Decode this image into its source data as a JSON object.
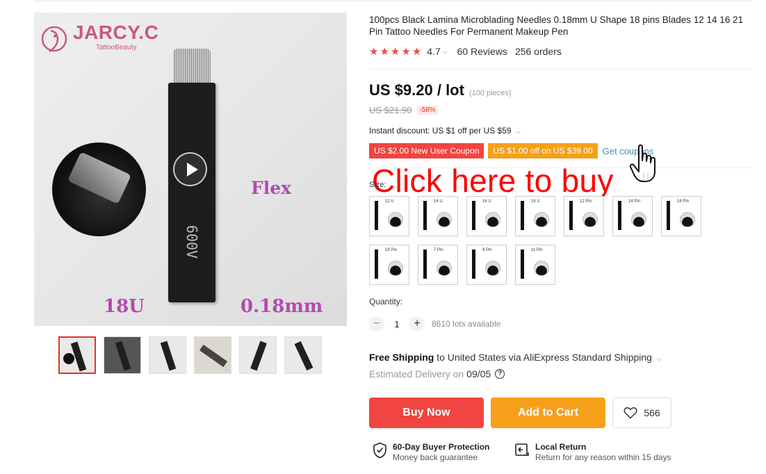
{
  "product": {
    "title": "100pcs Black Lamina Microblading Needles 0.18mm U Shape 18 pins Blades 12 14 16 21 Pin Tattoo Needles For Permanent Makeup Pen",
    "rating": "4.7",
    "reviews": "60 Reviews",
    "orders": "256 orders",
    "star_color": "#f04b4b"
  },
  "image": {
    "logo": "JARCY.C",
    "logo_sub": "TattooBeauty",
    "label_flex": "Flex",
    "label_size": "18U",
    "label_mm": "0.18mm",
    "blade_marking": "600V",
    "thumbnail_count": 6
  },
  "price": {
    "current": "US $9.20 / lot",
    "pieces": "(100 pieces)",
    "original": "US $21.90",
    "discount": "-58%"
  },
  "promotions": {
    "instant_discount": "Instant discount: US $1 off per US $59",
    "coupon_new_user": "US $2.00 New User Coupon",
    "coupon_spend": "US $1.00 off on US $39.00",
    "get_coupons": "Get coupons"
  },
  "overlay": {
    "click_here": "Click here to buy"
  },
  "size": {
    "label": "Size:",
    "options": [
      "12 U",
      "14 U",
      "16 U",
      "18 U",
      "12 Pin",
      "14 Pin",
      "16 Pin",
      "18 Pin",
      "7 Pin",
      "9 Pin",
      "11 Pin"
    ]
  },
  "quantity": {
    "label": "Quantity:",
    "minus": "−",
    "value": "1",
    "plus": "+",
    "available": "8610 lots available"
  },
  "shipping": {
    "title": "Free Shipping",
    "detail": "to United States via AliExpress Standard Shipping",
    "estimated": "Estimated Delivery on",
    "date": "09/05"
  },
  "actions": {
    "buy_now": "Buy Now",
    "add_to_cart": "Add to Cart",
    "wishlist_count": "566",
    "buy_color": "#f04540",
    "cart_color": "#f6a01a"
  },
  "guarantees": {
    "protection_title": "60-Day Buyer Protection",
    "protection_sub": "Money back guarantee",
    "return_title": "Local Return",
    "return_sub": "Return for any reason within 15 days"
  }
}
